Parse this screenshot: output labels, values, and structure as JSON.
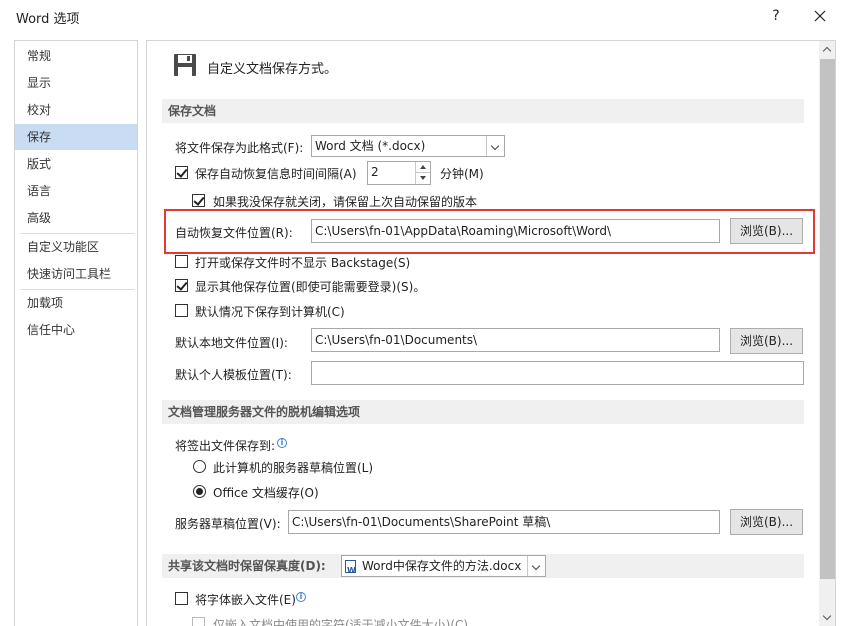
{
  "window": {
    "title": "Word 选项",
    "help": "?"
  },
  "nav": {
    "items": [
      {
        "label": "常规"
      },
      {
        "label": "显示"
      },
      {
        "label": "校对"
      },
      {
        "label": "保存"
      },
      {
        "label": "版式"
      },
      {
        "label": "语言"
      },
      {
        "label": "高级"
      },
      {
        "label": "自定义功能区"
      },
      {
        "label": "快速访问工具栏"
      },
      {
        "label": "加载项"
      },
      {
        "label": "信任中心"
      }
    ],
    "selected": "保存"
  },
  "content": {
    "heading": "自定义文档保存方式。",
    "save_section": {
      "title": "保存文档",
      "format_label": "将文件保存为此格式(F):",
      "format_value": "Word 文档 (*.docx)",
      "autorecover_label": "保存自动恢复信息时间间隔(A)",
      "autorecover_checked": true,
      "autorecover_minutes": "2",
      "minutes_label": "分钟(M)",
      "keep_last_label": "如果我没保存就关闭，请保留上次自动保留的版本",
      "keep_last_checked": true,
      "autorecover_location_label": "自动恢复文件位置(R):",
      "autorecover_location_value": "C:\\Users\\fn-01\\AppData\\Roaming\\Microsoft\\Word\\",
      "browse_label": "浏览(B)...",
      "no_backstage_label": "打开或保存文件时不显示 Backstage(S)",
      "no_backstage_checked": false,
      "show_other_label": "显示其他保存位置(即使可能需要登录)(S)。",
      "show_other_checked": true,
      "default_computer_label": "默认情况下保存到计算机(C)",
      "default_computer_checked": false,
      "local_location_label": "默认本地文件位置(I):",
      "local_location_value": "C:\\Users\\fn-01\\Documents\\",
      "template_location_label": "默认个人模板位置(T):",
      "template_location_value": ""
    },
    "offline_section": {
      "title": "文档管理服务器文件的脱机编辑选项",
      "checkout_label": "将签出文件保存到:",
      "radio_server_label": "此计算机的服务器草稿位置(L)",
      "radio_server_checked": false,
      "radio_office_label": "Office 文档缓存(O)",
      "radio_office_checked": true,
      "drafts_label": "服务器草稿位置(V):",
      "drafts_value": "C:\\Users\\fn-01\\Documents\\SharePoint 草稿\\"
    },
    "fidelity_section": {
      "title": "共享该文档时保留保真度(D):",
      "document_value": "Word中保存文件的方法.docx",
      "embed_fonts_label": "将字体嵌入文件(E)",
      "embed_fonts_checked": false,
      "embed_used_label": "仅嵌入文档中使用的字符(适于减小文件大小)(C)"
    }
  },
  "colors": {
    "highlight": "#e53935",
    "selected_nav": "#c9dcf2",
    "section_bg": "#f0f0f0",
    "info": "#3b7fd6"
  }
}
